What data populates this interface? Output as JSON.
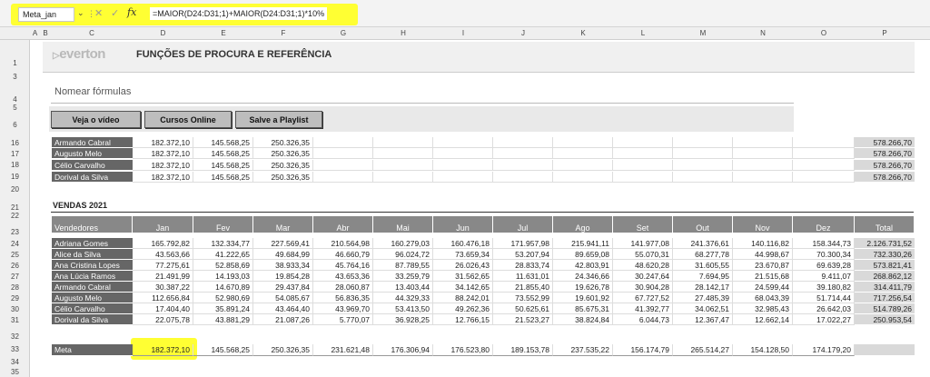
{
  "formula_bar": {
    "name_box": "Meta_jan",
    "formula": "=MAIOR(D24:D31;1)+MAIOR(D24:D31;1)*10%"
  },
  "columns": [
    "A",
    "B",
    "C",
    "D",
    "E",
    "F",
    "G",
    "H",
    "I",
    "J",
    "K",
    "L",
    "M",
    "N",
    "O",
    "P"
  ],
  "row_numbers": [
    "1",
    "3",
    "4",
    "5",
    "6",
    "16",
    "17",
    "18",
    "19",
    "20",
    "21",
    "22",
    "23",
    "24",
    "25",
    "26",
    "27",
    "28",
    "29",
    "30",
    "31",
    "32",
    "33",
    "34",
    "35"
  ],
  "banner": {
    "logo": "everton",
    "title": "FUNÇÕES DE PROCURA E REFERÊNCIA"
  },
  "subtitle": "Nomear fórmulas",
  "buttons": [
    "Veja o vídeo",
    "Cursos Online",
    "Salve a Playlist"
  ],
  "top_table": [
    {
      "name": "Armando Cabral",
      "values": [
        "182.372,10",
        "145.568,25",
        "250.326,35"
      ],
      "total": "578.266,70"
    },
    {
      "name": "Augusto Melo",
      "values": [
        "182.372,10",
        "145.568,25",
        "250.326,35"
      ],
      "total": "578.266,70"
    },
    {
      "name": "Célio Carvalho",
      "values": [
        "182.372,10",
        "145.568,25",
        "250.326,35"
      ],
      "total": "578.266,70"
    },
    {
      "name": "Dorival da Silva",
      "values": [
        "182.372,10",
        "145.568,25",
        "250.326,35"
      ],
      "total": "578.266,70"
    }
  ],
  "sales": {
    "title": "VENDAS 2021",
    "headers": [
      "Vendedores",
      "Jan",
      "Fev",
      "Mar",
      "Abr",
      "Mai",
      "Jun",
      "Jul",
      "Ago",
      "Set",
      "Out",
      "Nov",
      "Dez",
      "Total"
    ],
    "rows": [
      {
        "name": "Adriana Gomes",
        "values": [
          "165.792,82",
          "132.334,77",
          "227.569,41",
          "210.564,98",
          "160.279,03",
          "160.476,18",
          "171.957,98",
          "215.941,11",
          "141.977,08",
          "241.376,61",
          "140.116,82",
          "158.344,73"
        ],
        "total": "2.126.731,52"
      },
      {
        "name": "Alice da Silva",
        "values": [
          "43.563,66",
          "41.222,65",
          "49.684,99",
          "46.660,79",
          "96.024,72",
          "73.659,34",
          "53.207,94",
          "89.659,08",
          "55.070,31",
          "68.277,78",
          "44.998,67",
          "70.300,34"
        ],
        "total": "732.330,26"
      },
      {
        "name": "Ana Cristina Lopes",
        "values": [
          "77.275,61",
          "52.858,69",
          "38.933,34",
          "45.764,16",
          "87.789,55",
          "26.026,43",
          "28.833,74",
          "42.803,91",
          "48.620,28",
          "31.605,55",
          "23.670,87",
          "69.639,28"
        ],
        "total": "573.821,41"
      },
      {
        "name": "Ana Lúcia Ramos",
        "values": [
          "21.491,99",
          "14.193,03",
          "19.854,28",
          "43.653,36",
          "33.259,79",
          "31.562,65",
          "11.631,01",
          "24.346,66",
          "30.247,64",
          "7.694,95",
          "21.515,68",
          "9.411,07"
        ],
        "total": "268.862,12"
      },
      {
        "name": "Armando Cabral",
        "values": [
          "30.387,22",
          "14.670,89",
          "29.437,84",
          "28.060,87",
          "13.403,44",
          "34.142,65",
          "21.855,40",
          "19.626,78",
          "30.904,28",
          "28.142,17",
          "24.599,44",
          "39.180,82"
        ],
        "total": "314.411,79"
      },
      {
        "name": "Augusto Melo",
        "values": [
          "112.656,84",
          "52.980,69",
          "54.085,67",
          "56.836,35",
          "44.329,33",
          "88.242,01",
          "73.552,99",
          "19.601,92",
          "67.727,52",
          "27.485,39",
          "68.043,39",
          "51.714,44"
        ],
        "total": "717.256,54"
      },
      {
        "name": "Célio Carvalho",
        "values": [
          "17.404,40",
          "35.891,24",
          "43.464,40",
          "43.969,70",
          "53.413,50",
          "49.262,36",
          "50.625,61",
          "85.675,31",
          "41.392,77",
          "34.062,51",
          "32.985,43",
          "26.642,03"
        ],
        "total": "514.789,26"
      },
      {
        "name": "Dorival da Silva",
        "values": [
          "22.075,78",
          "43.881,29",
          "21.087,26",
          "5.770,07",
          "36.928,25",
          "12.766,15",
          "21.523,27",
          "38.824,84",
          "6.044,73",
          "12.367,47",
          "12.662,14",
          "17.022,27"
        ],
        "total": "250.953,54"
      }
    ],
    "meta": {
      "label": "Meta",
      "values": [
        "182.372,10",
        "145.568,25",
        "250.326,35",
        "231.621,48",
        "176.306,94",
        "176.523,80",
        "189.153,78",
        "237.535,22",
        "156.174,79",
        "265.514,27",
        "154.128,50",
        "174.179,20"
      ]
    }
  },
  "colors": {
    "highlight": "#ffff33",
    "name_bg": "#666666",
    "header_bg": "#888888",
    "total_bg": "#d9d9d9"
  }
}
